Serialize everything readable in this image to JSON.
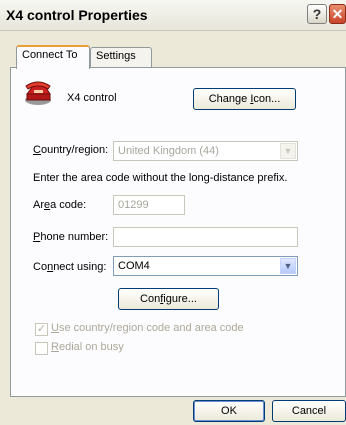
{
  "window": {
    "title": "X4 control Properties",
    "help_glyph": "?",
    "close_glyph": "✕"
  },
  "tabs": [
    {
      "label": "Connect To",
      "active": true
    },
    {
      "label": "Settings",
      "active": false
    }
  ],
  "connection": {
    "name": "X4 control",
    "change_icon_pre": "Change ",
    "change_icon_u": "I",
    "change_icon_post": "con..."
  },
  "country": {
    "label_u": "C",
    "label_rest": "ountry/region:",
    "value": "United Kingdom (44)"
  },
  "instruction": "Enter the area code without the long-distance prefix.",
  "area_code": {
    "label_pre": "Ar",
    "label_u": "e",
    "label_post": "a code:",
    "value": "01299"
  },
  "phone": {
    "label_u": "P",
    "label_rest": "hone number:",
    "value": ""
  },
  "connect_using": {
    "label_pre": "Co",
    "label_u": "n",
    "label_post": "nect using:",
    "value": "COM4"
  },
  "configure": {
    "pre": "Con",
    "u": "f",
    "post": "igure..."
  },
  "checkboxes": {
    "use_country": {
      "u": "U",
      "rest": "se country/region code and area code",
      "checked": true
    },
    "redial": {
      "u": "R",
      "rest": "edial on busy",
      "checked": false
    }
  },
  "footer": {
    "ok": "OK",
    "cancel": "Cancel"
  },
  "colors": {
    "tab_accent": "#e8a03a",
    "close_button": "#c9442a",
    "disabled_text": "#a7a69c"
  }
}
